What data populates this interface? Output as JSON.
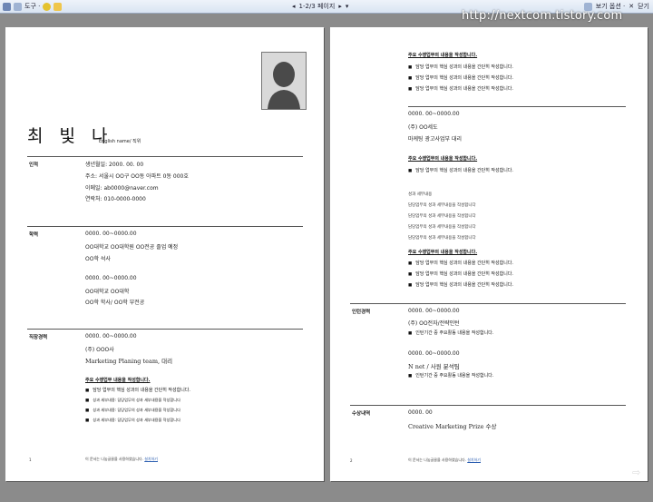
{
  "toolbar": {
    "tools_label": "도구 ·",
    "pager": "1-2/3 페이지",
    "view_options": "보기 옵션 ·",
    "close": "닫기"
  },
  "watermark": "http://nextcom.tistory.com",
  "page1": {
    "name": "최 빛 나",
    "name_sub": "English name/ 직위",
    "sections": {
      "personal_label": "인적",
      "personal": [
        "생년월일: 2000. 00. 00",
        "주소: 서울시 OO구 OO동 아파트 0동 000호",
        "이메일: ab0000@naver.com",
        "연락처: 010-0000-0000"
      ],
      "education_label": "학력",
      "education": [
        "0000. 00~0000.00",
        "OO대학교 OO대학원 OO전공 졸업 예정",
        "OO학 석사",
        "0000. 00~0000.00",
        "OO대학교 OO대학",
        "OO학 학사/ OO학 부전공"
      ],
      "career_label": "직장경력",
      "career": [
        "0000. 00~0000.00",
        "(주) OOO사",
        "Marketing Planing team, 대리"
      ],
      "career_header": "주요 수행업무 내용을 작성합니다.",
      "career_bullets": [
        "담당 업무의 핵심 성과의 내용을 간단히 작성합니다.",
        "성과 세부내용: 담당업무의 성과 세부내용을 작성합니다",
        "성과 세부내용: 담당업무의 성과 세부내용을 작성합니다",
        "성과 세부내용: 담당업무의 성과 세부내용을 작성합니다"
      ]
    },
    "footer_text": "이 문서는 나눔글꼴을 사용하였습니다.",
    "footer_link": "설치하기",
    "page_number": "1"
  },
  "page2": {
    "block1_header": "주요 수행업무의 내용을 작성합니다.",
    "block1_bullets": [
      "담당 업무의 핵심 성과의 내용을 간단히 작성합니다.",
      "담당 업무의 핵심 성과의 내용을 간단히 작성합니다.",
      "담당 업무의 핵심 성과의 내용을 간단히 작성합니다."
    ],
    "block2": [
      "0000. 00~0000.00",
      "(주) OO세도",
      "마케팅 광고사업부 대리"
    ],
    "block2_header": "주요 수행업무의 내용을 작성합니다.",
    "block2_bullets": [
      "담당 업무의 핵심 성과의 내용을 간단히 작성합니다."
    ],
    "block2_details": [
      "성과 세부내용",
      "담당업무의 성과 세부내용을 작성합니다",
      "담당업무의 성과 세부내용을 작성합니다",
      "담당업무의 성과 세부내용을 작성합니다",
      "담당업무의 성과 세부내용을 작성합니다"
    ],
    "block3_header": "주요 수행업무의 내용을 작성합니다.",
    "block3_bullets": [
      "담당 업무의 핵심 성과의 내용을 간단히 작성합니다.",
      "담당 업무의 핵심 성과의 내용을 간단히 작성합니다.",
      "담당 업무의 핵심 성과의 내용을 간단히 작성합니다."
    ],
    "intern_label": "인턴경력",
    "intern1": [
      "0000. 00~0000.00",
      "(주) OO전자/전략인턴"
    ],
    "intern1_bullet": "인턴기간 중 주요활동 내용을 작성합니다.",
    "intern2": [
      "0000. 00~0000.00",
      "N net / 사원 분석팀"
    ],
    "intern2_bullet": "인턴기간 중 주요활동 내용을 작성합니다.",
    "award_label": "수상내역",
    "award": [
      "0000. 00",
      "Creative Marketing Prize 수상"
    ],
    "footer_text": "이 문서는 나눔글꼴을 사용하였습니다.",
    "footer_link": "설치하기",
    "page_number": "2"
  },
  "colors": {
    "toolbar_bg": "#dfe8f4",
    "page_bg": "#ffffff",
    "viewer_bg": "#8b8b8b",
    "link": "#2a5db0"
  }
}
